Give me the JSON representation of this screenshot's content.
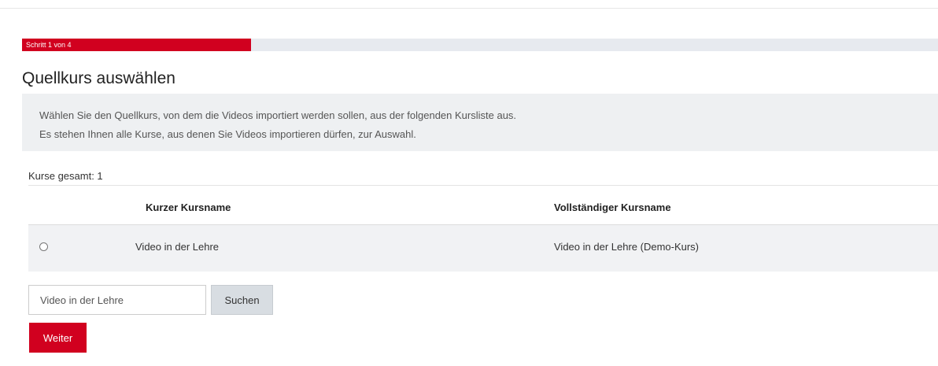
{
  "progress": {
    "label": "Schritt 1 von 4",
    "fraction": 0.25,
    "fill_color": "#d1001f",
    "track_color": "#e7eaef"
  },
  "page_title": "Quellkurs auswählen",
  "info": {
    "line1": "Wählen Sie den Quellkurs, von dem die Videos importiert werden sollen, aus der folgenden Kursliste aus.",
    "line2": "Es stehen Ihnen alle Kurse, aus denen Sie Videos importieren dürfen, zur Auswahl."
  },
  "courses_total": "Kurse gesamt: 1",
  "table": {
    "headers": {
      "short_name": "Kurzer Kursname",
      "full_name": "Vollständiger Kursname"
    },
    "rows": [
      {
        "short_name": "Video in der Lehre",
        "full_name": "Video in der Lehre (Demo-Kurs)",
        "selected": false
      }
    ]
  },
  "search": {
    "value": "Video in der Lehre",
    "button_label": "Suchen"
  },
  "next_button_label": "Weiter",
  "colors": {
    "accent": "#d1001f",
    "info_background": "#eef0f2",
    "row_background": "#f1f2f4",
    "search_button_background": "#d8dde2"
  }
}
